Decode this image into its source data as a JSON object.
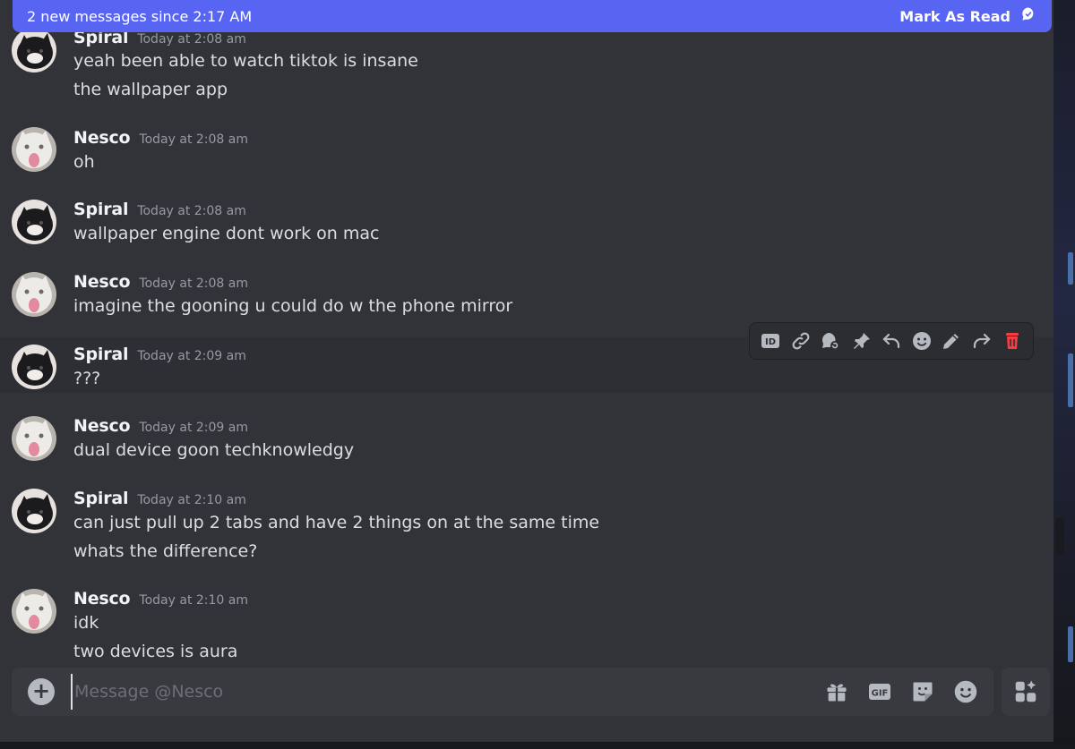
{
  "banner": {
    "text": "2 new messages since 2:17 AM",
    "action_label": "Mark As Read",
    "action_icon": "mark-read-icon"
  },
  "messages": [
    {
      "author": "Spiral",
      "timestamp": "Today at 2:08 am",
      "lines": [
        "yeah been able to watch tiktok is insane",
        "the wallpaper app"
      ],
      "avatar": "black-cat-avatar"
    },
    {
      "author": "Nesco",
      "timestamp": "Today at 2:08 am",
      "lines": [
        "oh"
      ],
      "avatar": "white-cat-avatar"
    },
    {
      "author": "Spiral",
      "timestamp": "Today at 2:08 am",
      "lines": [
        "wallpaper engine dont work on mac"
      ],
      "avatar": "black-cat-avatar"
    },
    {
      "author": "Nesco",
      "timestamp": "Today at 2:08 am",
      "lines": [
        "imagine the gooning u could do w the phone mirror"
      ],
      "avatar": "white-cat-avatar"
    },
    {
      "author": "Spiral",
      "timestamp": "Today at 2:09 am",
      "lines": [
        "???"
      ],
      "avatar": "black-cat-avatar"
    },
    {
      "author": "Nesco",
      "timestamp": "Today at 2:09 am",
      "lines": [
        "dual device goon techknowledgy"
      ],
      "avatar": "white-cat-avatar"
    },
    {
      "author": "Spiral",
      "timestamp": "Today at 2:10 am",
      "lines": [
        "can just pull up 2 tabs and have 2 things on at the same time",
        "whats the difference?"
      ],
      "avatar": "black-cat-avatar"
    },
    {
      "author": "Nesco",
      "timestamp": "Today at 2:10 am",
      "lines": [
        "idk",
        "two devices is aura"
      ],
      "avatar": "white-cat-avatar"
    }
  ],
  "toolbar": {
    "icons": [
      "copy-id-icon",
      "copy-link-icon",
      "create-thread-icon",
      "pin-icon",
      "reply-icon",
      "add-reaction-icon",
      "edit-icon",
      "forward-icon",
      "delete-icon"
    ],
    "delete_color": "#f23f43"
  },
  "composer": {
    "placeholder": "Message @Nesco",
    "value": "",
    "gif_label": "GIF",
    "icons": [
      "gift-icon",
      "gif-icon",
      "sticker-icon",
      "emoji-icon",
      "apps-icon"
    ]
  },
  "colors": {
    "accent": "#5865f2",
    "background": "#323339",
    "composer": "#383a40",
    "danger": "#f23f43"
  }
}
